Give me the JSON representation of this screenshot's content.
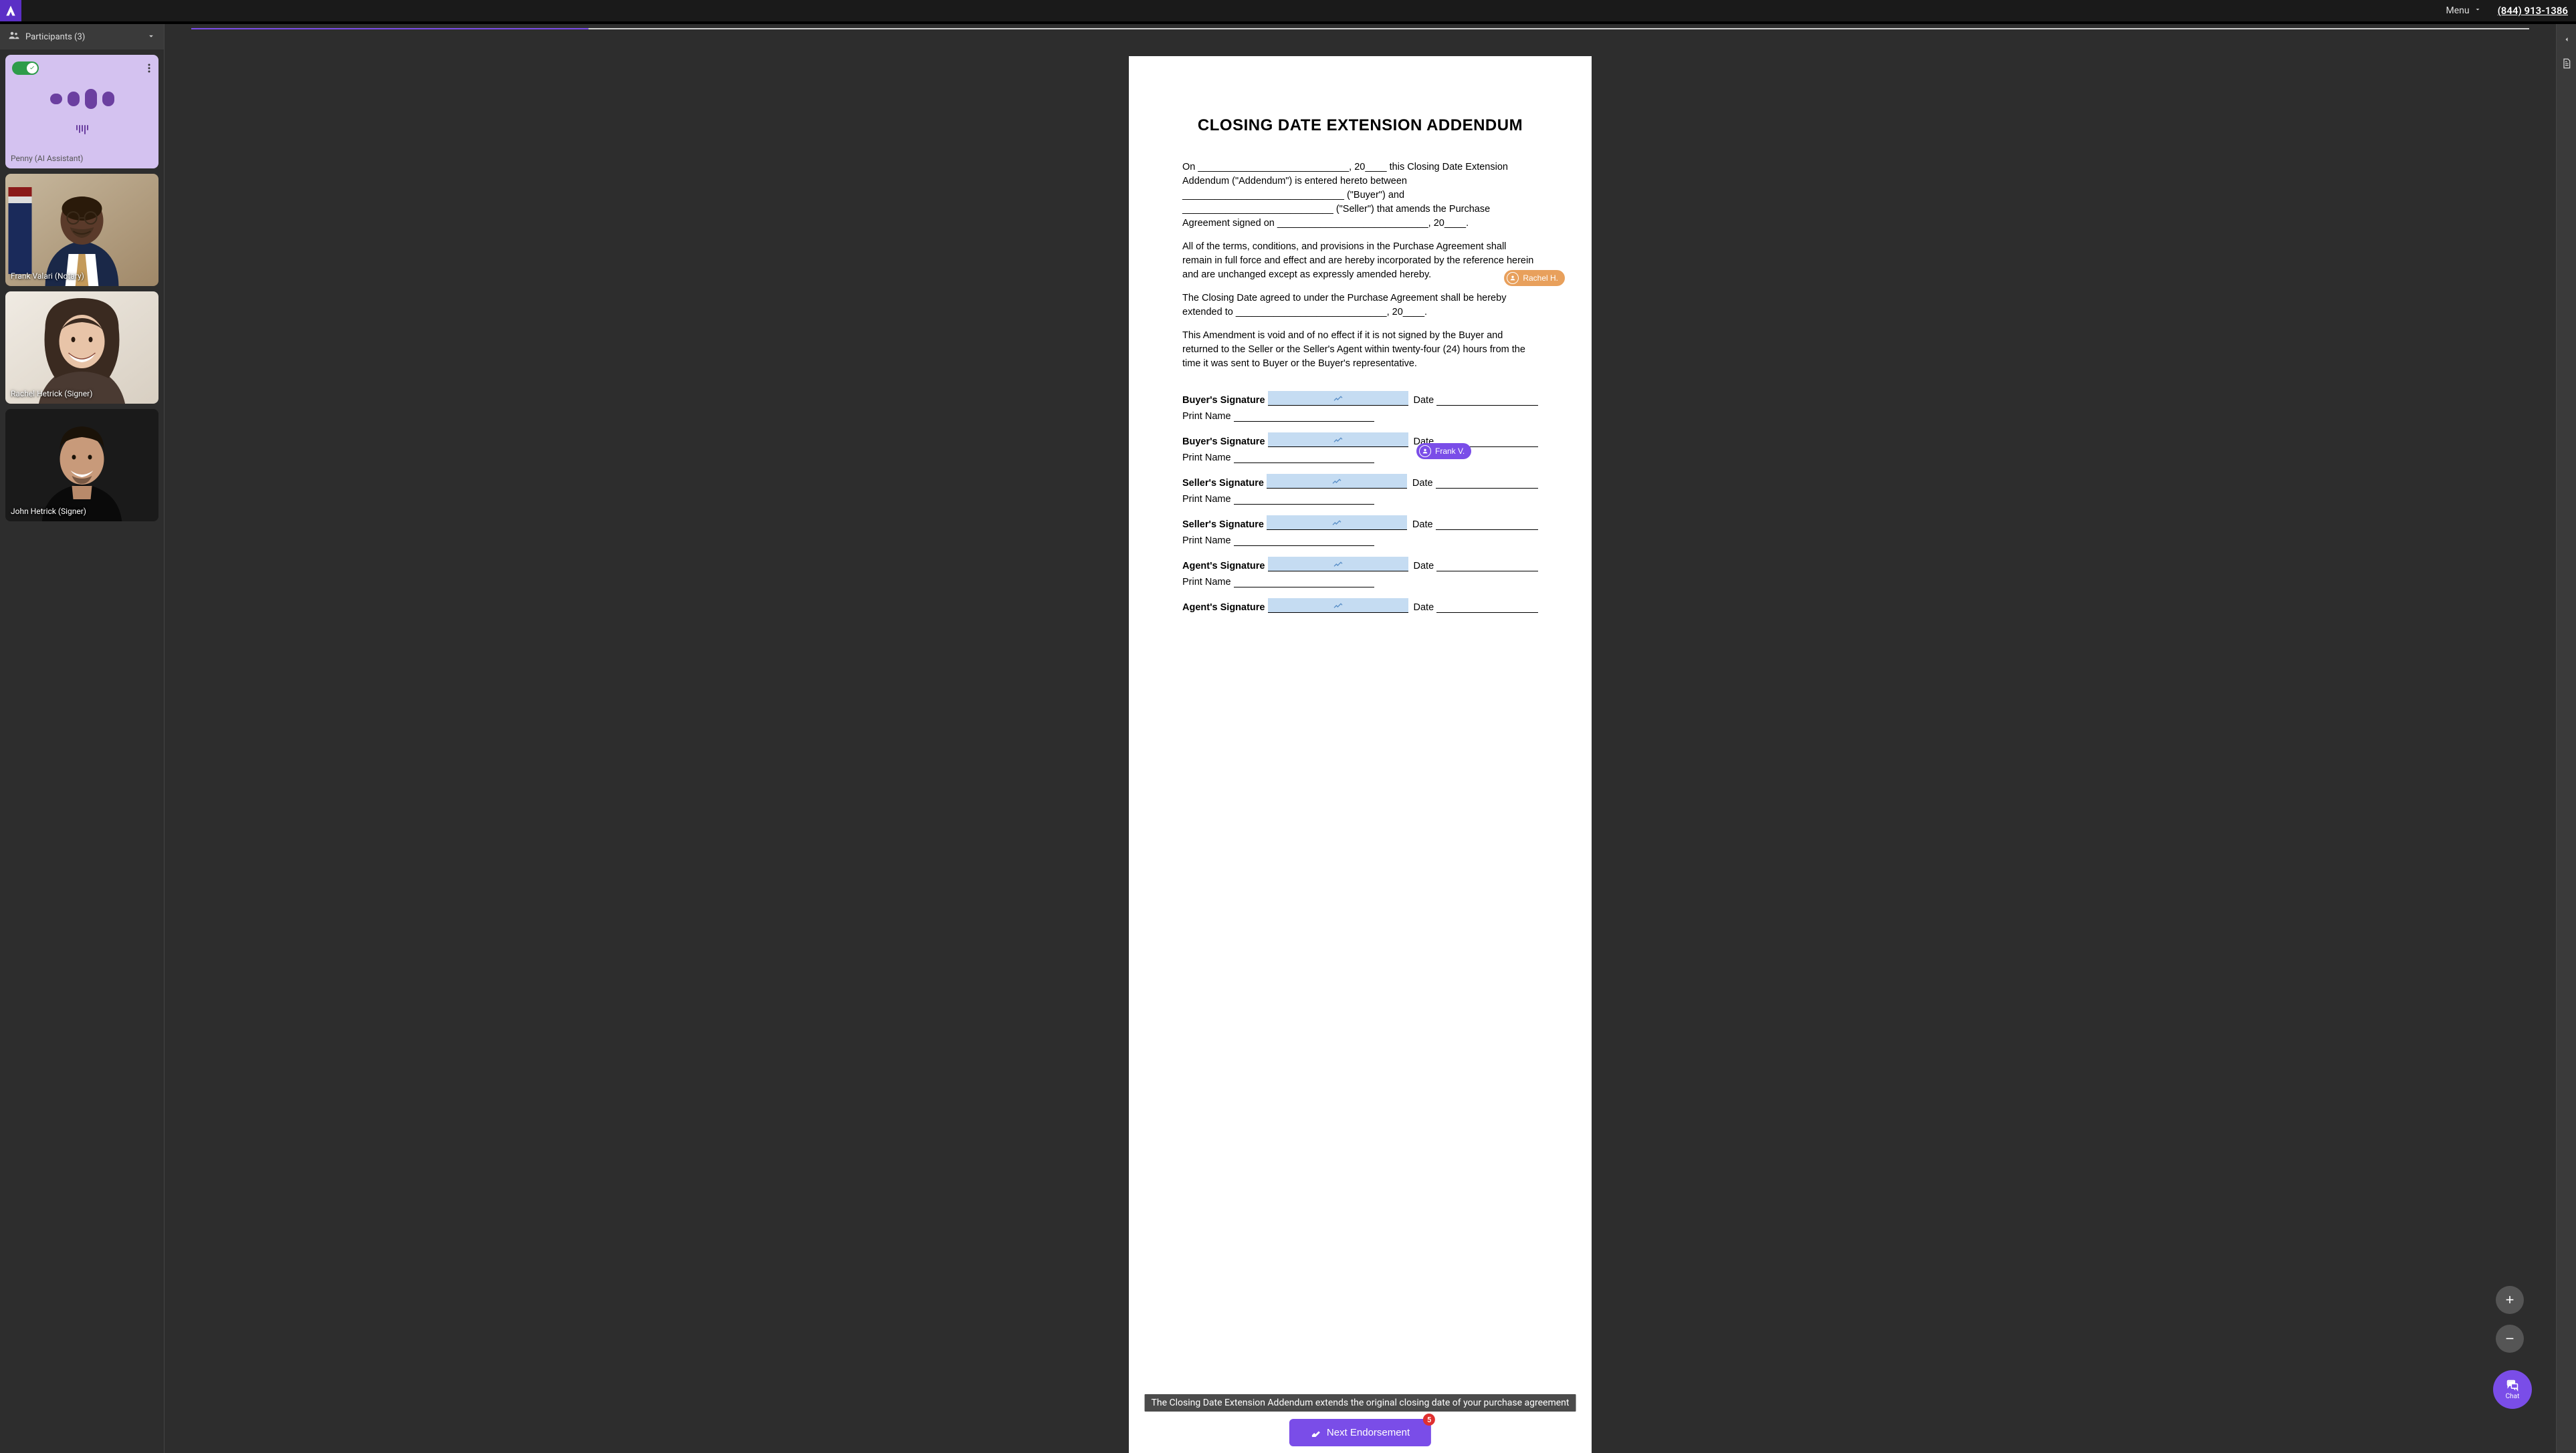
{
  "topbar": {
    "menu_label": "Menu",
    "phone": "(844) 913-1386"
  },
  "sidebar": {
    "participants_header": "Participants (3)",
    "participants": [
      {
        "name": "Penny (AI Assistant)",
        "type": "ai"
      },
      {
        "name": "Frank Valari (Notary)",
        "type": "video"
      },
      {
        "name": "Rachel Hetrick (Signer)",
        "type": "video"
      },
      {
        "name": "John Hetrick (Signer)",
        "type": "video"
      }
    ]
  },
  "document": {
    "title": "CLOSING DATE EXTENSION ADDENDUM",
    "p1": "On ____________________________, 20____ this Closing Date Extension Addendum (\"Addendum\") is entered hereto between ______________________________ (\"Buyer\") and ____________________________ (\"Seller\") that amends the Purchase Agreement signed on ____________________________, 20____.",
    "p2": "All of the terms, conditions, and provisions in the Purchase Agreement shall remain in full force and effect and are hereby incorporated by the reference herein and are unchanged except as expressly amended hereby.",
    "p3": "The Closing Date agreed to under the Purchase Agreement shall be hereby extended to ____________________________, 20____.",
    "p4": "This Amendment is void and of no effect if it is not signed by the Buyer and returned to the Seller or the Seller's Agent within twenty-four (24) hours from the time it was sent to Buyer or the Buyer's representative.",
    "labels": {
      "buyer_sig": "Buyer's Signature",
      "seller_sig": "Seller's Signature",
      "agent_sig": "Agent's Signature",
      "print_name": "Print Name",
      "date": "Date"
    },
    "cursors": {
      "rachel": "Rachel H.",
      "frank": "Frank V."
    }
  },
  "caption": "The Closing Date Extension Addendum extends the original closing date of your purchase agreement",
  "bottom": {
    "next_label": "Next Endorsement",
    "badge": "5"
  },
  "chat": {
    "label": "Chat"
  },
  "zoom": {
    "plus": "+",
    "minus": "−"
  }
}
